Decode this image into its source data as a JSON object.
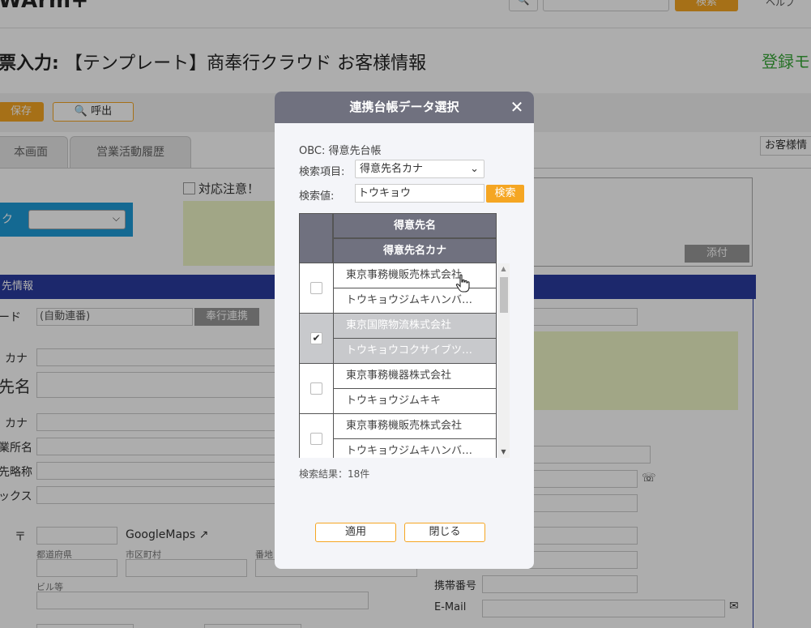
{
  "header": {
    "logo": "WArm+",
    "search_button": "検索",
    "user": "ヘルプ"
  },
  "page": {
    "title_prefix": "票入力:",
    "title": "【テンプレート】商奉行クラウド お客様情報",
    "mode": "登録モ"
  },
  "toolbar": {
    "save_label": "保存",
    "call_label": "呼出"
  },
  "tabs": {
    "main": "本画面",
    "history": "営業活動履歴",
    "customer_info": "お客様情"
  },
  "blue_box": {
    "label": "ク"
  },
  "attention_label": "対応注意！",
  "attach_label": "添付",
  "section_title": "先情報",
  "form": {
    "code_label": "ード",
    "code_value": "(自動連番)",
    "link_button": "奉行連携",
    "kana_label": "カナ",
    "name_label": "先名",
    "kana2_label": "カナ",
    "office_label": "業所名",
    "short_label": "先略称",
    "fax_label": "ックス",
    "zip_label": "〒",
    "googlemaps": "GoogleMaps",
    "prefecture_label": "都道府県",
    "city_label": "市区町村",
    "address_label": "番地",
    "building_label": "ビル等",
    "mobile_label": "携帯番号",
    "email_label": "E-Mail"
  },
  "modal": {
    "title": "連携台帳データ選択",
    "ledger": "OBC: 得意先台帳",
    "item_label": "検索項目:",
    "item_value": "得意先名カナ",
    "value_label": "検索値:",
    "value_input": "トウキョウ",
    "search_button": "検索",
    "columns": [
      "得意先名",
      "得意先名カナ"
    ],
    "rows": [
      {
        "name": "東京事務機販売株式会社",
        "kana": "トウキョウジムキハンバ…",
        "checked": false
      },
      {
        "name": "東京国際物流株式会社",
        "kana": "トウキョウコクサイブツ…",
        "checked": true
      },
      {
        "name": "東京事務機器株式会社",
        "kana": "トウキョウジムキキ",
        "checked": false
      },
      {
        "name": "東京事務機販売株式会社",
        "kana": "トウキョウジムキハンバ…",
        "checked": false
      }
    ],
    "result_count": "検索結果：18件",
    "apply_button": "適用",
    "close_button": "閉じる"
  }
}
